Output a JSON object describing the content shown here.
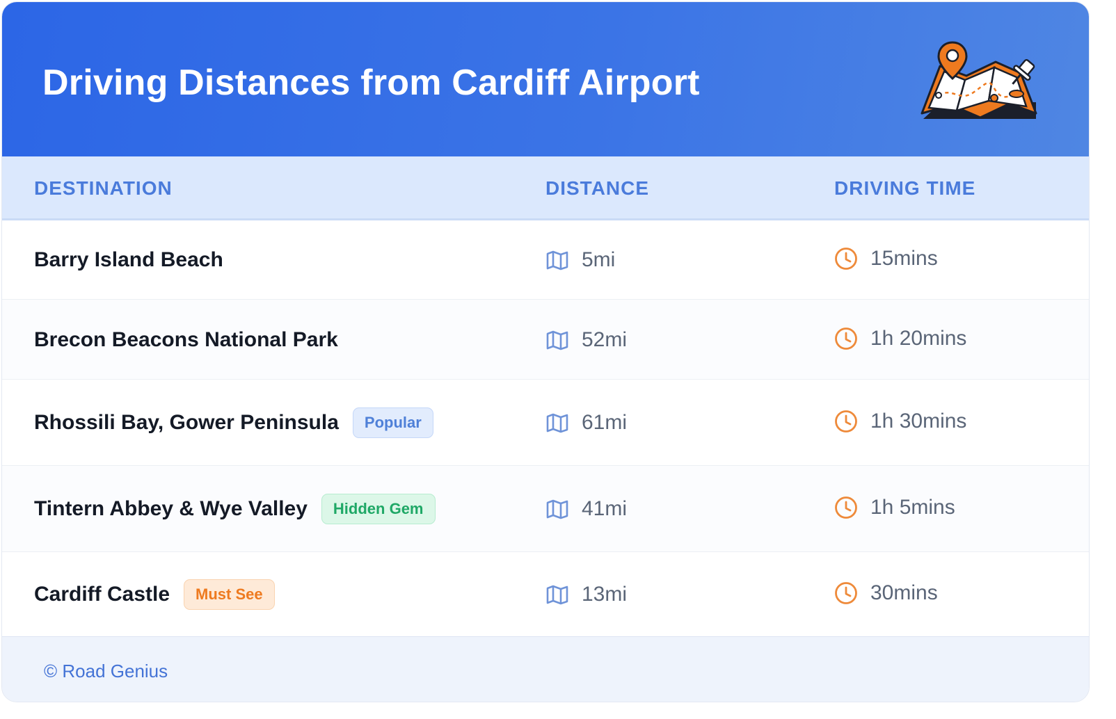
{
  "header": {
    "title": "Driving Distances from Cardiff Airport",
    "illustration": "map-with-pin-illustration"
  },
  "columns": {
    "destination": "DESTINATION",
    "distance": "DISTANCE",
    "driving_time": "DRIVING TIME"
  },
  "rows": [
    {
      "destination": "Barry Island Beach",
      "badge": null,
      "distance": "5mi",
      "time": "15mins"
    },
    {
      "destination": "Brecon Beacons National Park",
      "badge": null,
      "distance": "52mi",
      "time": "1h 20mins"
    },
    {
      "destination": "Rhossili Bay, Gower Peninsula",
      "badge": {
        "label": "Popular",
        "kind": "blue"
      },
      "distance": "61mi",
      "time": "1h 30mins"
    },
    {
      "destination": "Tintern Abbey & Wye Valley",
      "badge": {
        "label": "Hidden Gem",
        "kind": "green"
      },
      "distance": "41mi",
      "time": "1h 5mins"
    },
    {
      "destination": "Cardiff Castle",
      "badge": {
        "label": "Must See",
        "kind": "orange"
      },
      "distance": "13mi",
      "time": "30mins"
    }
  ],
  "icons": {
    "distance": "map-icon",
    "time": "clock-icon"
  },
  "footer": {
    "credit": "© Road Genius"
  },
  "colors": {
    "header_start": "#2c66e6",
    "header_end": "#4f86e3",
    "column_header_bg": "#dbe8fd",
    "column_header_text": "#4a7bdb",
    "map_icon": "#6f93d8",
    "clock_icon": "#ee8a3a",
    "badge_blue_bg": "#e2ecfd",
    "badge_blue_text": "#4f80d8",
    "badge_green_bg": "#dcf7e8",
    "badge_green_text": "#1fa866",
    "badge_orange_bg": "#feead8",
    "badge_orange_text": "#ee7a1f",
    "footer_text": "#4473d6"
  }
}
